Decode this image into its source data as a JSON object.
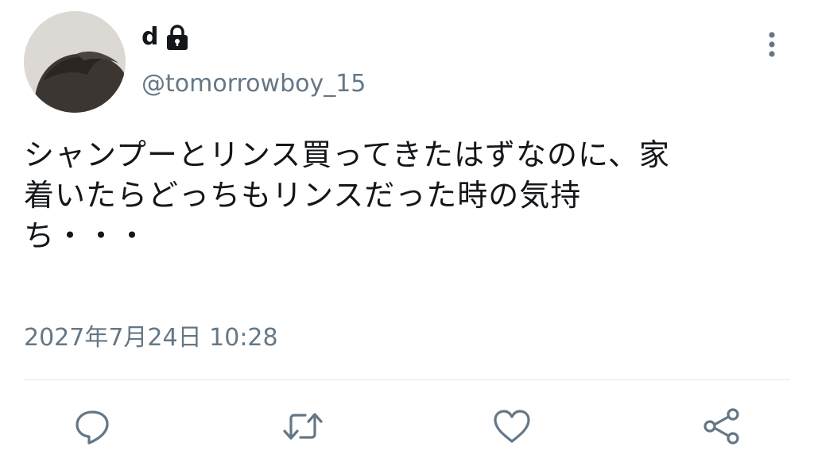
{
  "tweet": {
    "author": {
      "display_name": "d",
      "handle": "@tomorrowboy_15",
      "protected_icon": "lock-icon"
    },
    "text_lines": [
      "シャンプーとリンス買ってきたはずなのに、家",
      "着いたらどっちもリンスだった時の気持",
      "ち・・・"
    ],
    "timestamp": "2027年7月24日 10:28"
  },
  "actions": {
    "reply_icon": "comment-bubble-icon",
    "retweet_icon": "retweet-arrows-icon",
    "like_icon": "heart-outline-icon",
    "share_icon": "share-nodes-icon",
    "more_icon": "vertical-ellipsis-icon"
  },
  "colors": {
    "text_primary": "#14171a",
    "text_secondary": "#657786",
    "icon": "#657786",
    "divider": "#e1e8ed",
    "background": "#ffffff"
  }
}
